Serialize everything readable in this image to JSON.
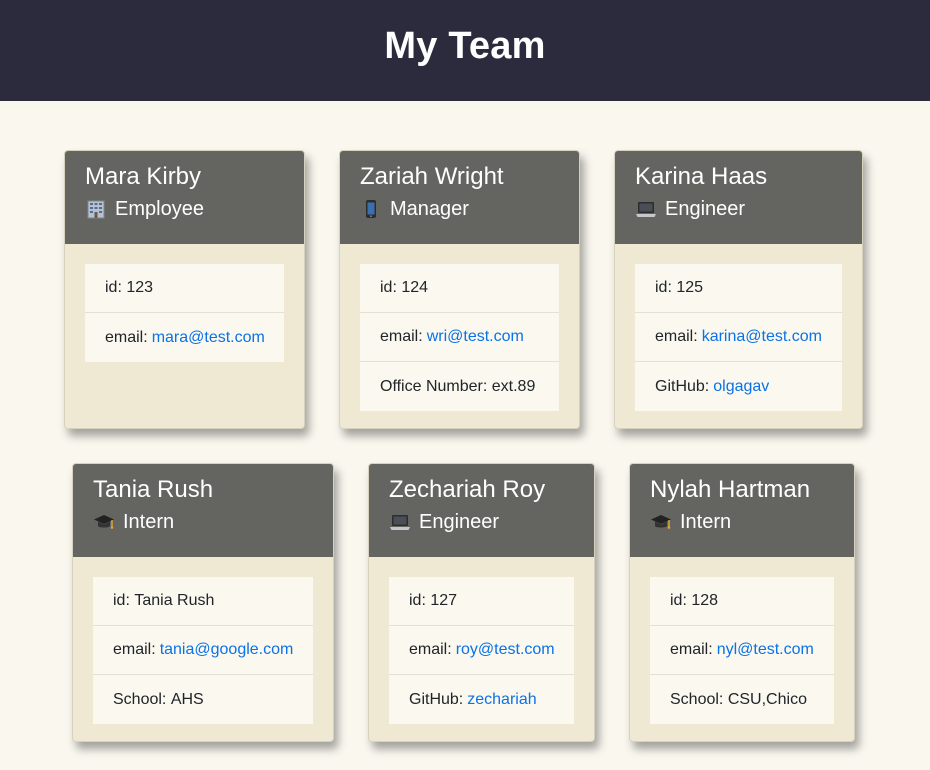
{
  "header": {
    "title": "My Team"
  },
  "cards": [
    {
      "name": "Mara Kirby",
      "role": "Employee",
      "icon": "office-building-icon",
      "id_label": "id:",
      "id": "123",
      "email_label": "email:",
      "email": "mara@test.com"
    },
    {
      "name": "Zariah Wright",
      "role": "Manager",
      "icon": "mobile-phone-icon",
      "id_label": "id:",
      "id": "124",
      "email_label": "email:",
      "email": "wri@test.com",
      "extra_label": "Office Number:",
      "extra": "ext.89"
    },
    {
      "name": "Karina Haas",
      "role": "Engineer",
      "icon": "laptop-icon",
      "id_label": "id:",
      "id": "125",
      "email_label": "email:",
      "email": "karina@test.com",
      "extra_label": "GitHub:",
      "extra": "olgagav"
    },
    {
      "name": "Tania Rush",
      "role": "Intern",
      "icon": "graduation-cap-icon",
      "id_label": "id:",
      "id": "Tania Rush",
      "email_label": "email:",
      "email": "tania@google.com",
      "extra_label": "School:",
      "extra": "AHS"
    },
    {
      "name": "Zechariah Roy",
      "role": "Engineer",
      "icon": "laptop-icon",
      "id_label": "id:",
      "id": "127",
      "email_label": "email:",
      "email": "roy@test.com",
      "extra_label": "GitHub:",
      "extra": "zechariah"
    },
    {
      "name": "Nylah Hartman",
      "role": "Intern",
      "icon": "graduation-cap-icon",
      "id_label": "id:",
      "id": "128",
      "email_label": "email:",
      "email": "nyl@test.com",
      "extra_label": "School:",
      "extra": "CSU,Chico"
    }
  ],
  "colors": {
    "header_bg": "#2c2b3e",
    "card_head_bg": "#646461",
    "card_body_bg": "#efe9d4",
    "page_bg": "#f9f7ee",
    "link": "#0b72e7"
  }
}
